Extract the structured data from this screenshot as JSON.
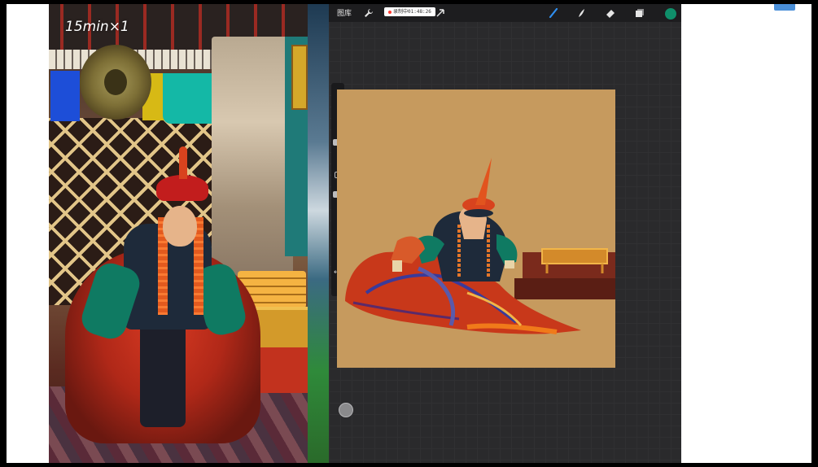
{
  "overlay": {
    "watermark": "15min×1"
  },
  "procreate": {
    "toolbar": {
      "gallery_label": "图库",
      "recording_status": "录制中01:48:26",
      "tools": [
        "wrench-icon",
        "magic-wand-icon",
        "selection-icon",
        "transform-arrow-icon",
        "brush-icon",
        "smudge-icon",
        "eraser-icon",
        "layers-icon"
      ],
      "active_color": "#0f8f6a"
    },
    "canvas": {
      "background": "#c69a5e"
    }
  },
  "colors": {
    "chrome": "#1d1d1f",
    "accent_blue": "#4a8fd8"
  }
}
